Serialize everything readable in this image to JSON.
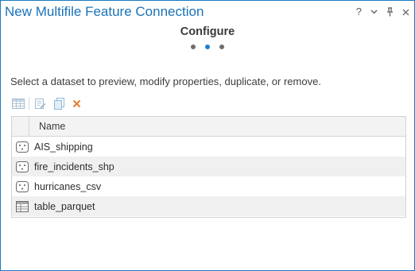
{
  "window": {
    "title": "New Multifile Feature Connection",
    "help_glyph": "?",
    "options_glyph": "⌄",
    "pin_glyph": "⊥",
    "close_glyph": "✕"
  },
  "step": {
    "title": "Configure",
    "total": 3,
    "current": 2
  },
  "instructions": "Select a dataset to preview, modify properties, duplicate, or remove.",
  "toolbar": {
    "buttons": [
      "table-view-icon",
      "properties-icon",
      "duplicate-icon",
      "remove-icon"
    ]
  },
  "table": {
    "column_header": "Name",
    "rows": [
      {
        "name": "AIS_shipping",
        "icon": "point-feature-icon"
      },
      {
        "name": "fire_incidents_shp",
        "icon": "point-feature-icon"
      },
      {
        "name": "hurricanes_csv",
        "icon": "point-feature-icon"
      },
      {
        "name": "table_parquet",
        "icon": "table-icon"
      }
    ]
  },
  "colors": {
    "accent": "#1a73b8",
    "active_dot": "#1e7fd0",
    "remove": "#e57c2e"
  }
}
